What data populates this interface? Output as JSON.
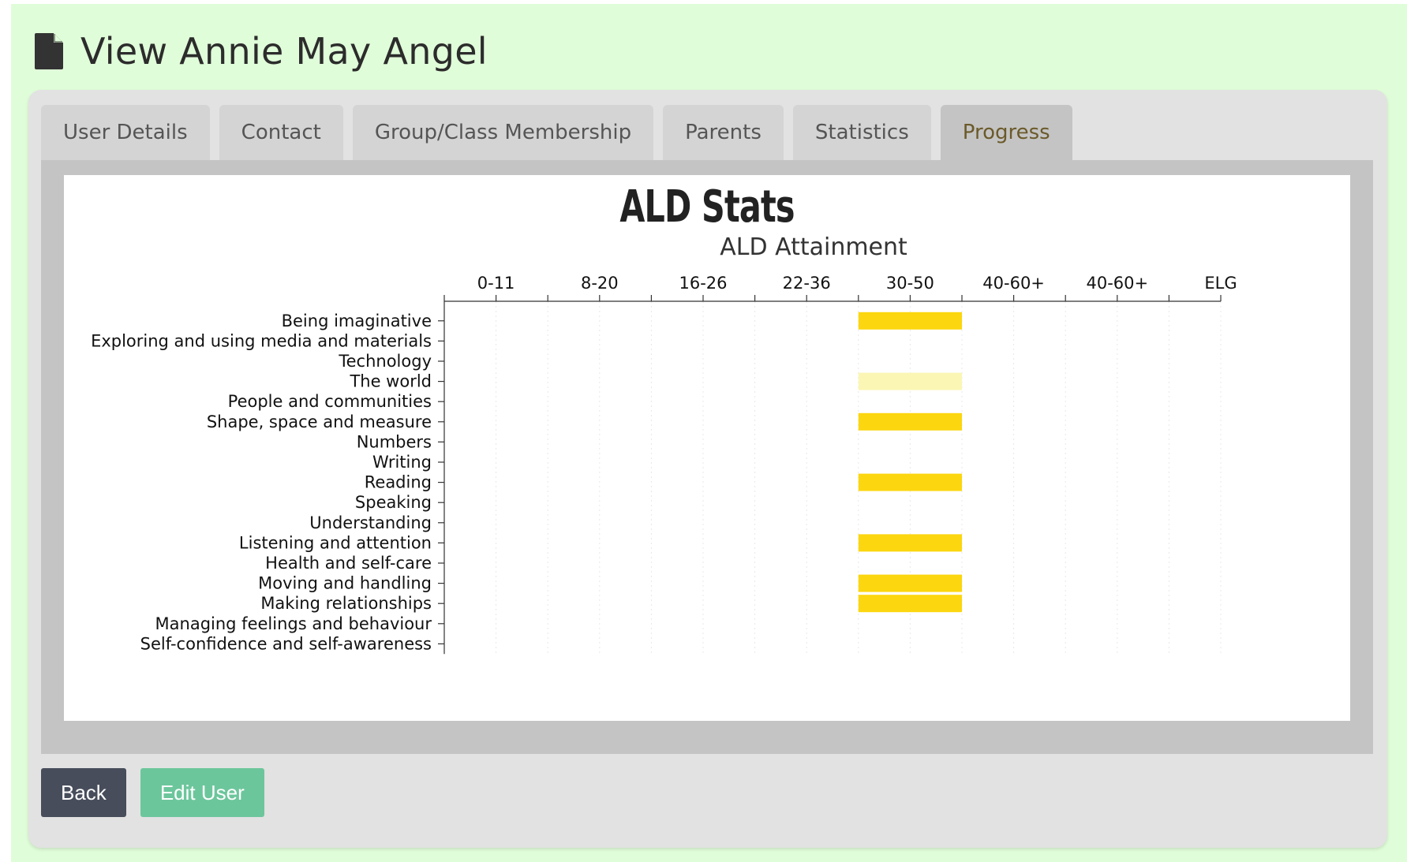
{
  "page": {
    "title": "View Annie May Angel",
    "icon": "file-icon"
  },
  "tabs": [
    {
      "label": "User Details",
      "active": false
    },
    {
      "label": "Contact",
      "active": false
    },
    {
      "label": "Group/Class Membership",
      "active": false
    },
    {
      "label": "Parents",
      "active": false
    },
    {
      "label": "Statistics",
      "active": false
    },
    {
      "label": "Progress",
      "active": true
    }
  ],
  "buttons": {
    "back": "Back",
    "edit": "Edit User"
  },
  "colors": {
    "page_bg": "#e0fdd9",
    "bar": "#fcd60f",
    "bar_light": "#fbf6b4",
    "back_button": "#474d5b",
    "edit_button": "#6cc69c"
  },
  "chart_data": {
    "type": "bar",
    "orientation": "horizontal",
    "title": "ALD Stats",
    "subtitle": "ALD Attainment",
    "x_ticks": [
      "0-11",
      "8-20",
      "16-26",
      "22-36",
      "30-50",
      "40-60+",
      "40-60+",
      "ELG"
    ],
    "grid": true,
    "categories": [
      "Being imaginative",
      "Exploring and using media and materials",
      "Technology",
      "The world",
      "People and communities",
      "Shape, space and measure",
      "Numbers",
      "Writing",
      "Reading",
      "Speaking",
      "Understanding",
      "Listening and attention",
      "Health and self-care",
      "Moving and handling",
      "Making relationships",
      "Managing feelings and behaviour",
      "Self-confidence and self-awareness"
    ],
    "values": [
      "30-50",
      null,
      null,
      "30-50",
      null,
      "30-50",
      null,
      null,
      "30-50",
      null,
      null,
      "30-50",
      null,
      "30-50",
      "30-50",
      null,
      null
    ],
    "highlighted": [
      true,
      false,
      false,
      false,
      false,
      true,
      false,
      false,
      true,
      false,
      false,
      true,
      false,
      true,
      true,
      false,
      false
    ]
  }
}
